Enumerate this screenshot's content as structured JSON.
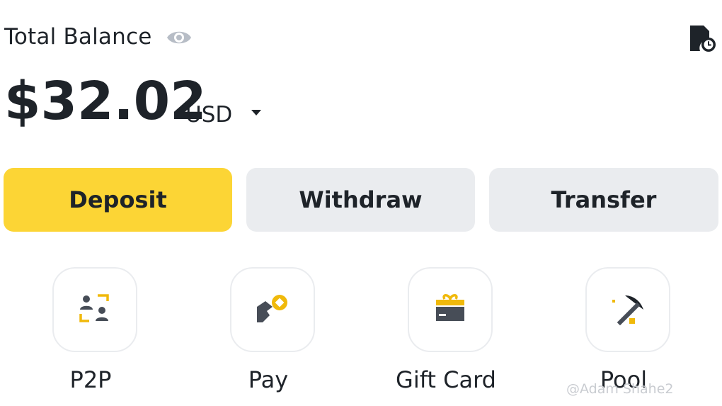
{
  "header": {
    "balance_label": "Total Balance",
    "amount": "$32.02",
    "currency": "USD"
  },
  "actions": {
    "deposit": "Deposit",
    "withdraw": "Withdraw",
    "transfer": "Transfer"
  },
  "shortcuts": [
    {
      "label": "P2P",
      "icon": "p2p-icon"
    },
    {
      "label": "Pay",
      "icon": "pay-icon"
    },
    {
      "label": "Gift Card",
      "icon": "gift-card-icon"
    },
    {
      "label": "Pool",
      "icon": "pool-icon"
    }
  ],
  "watermark": "@Adam Shahe2",
  "colors": {
    "primary": "#fcd535",
    "secondary_button": "#eaecef",
    "text": "#1e2329",
    "icon_gray": "#b7bdc6",
    "accent": "#f0b90b"
  }
}
